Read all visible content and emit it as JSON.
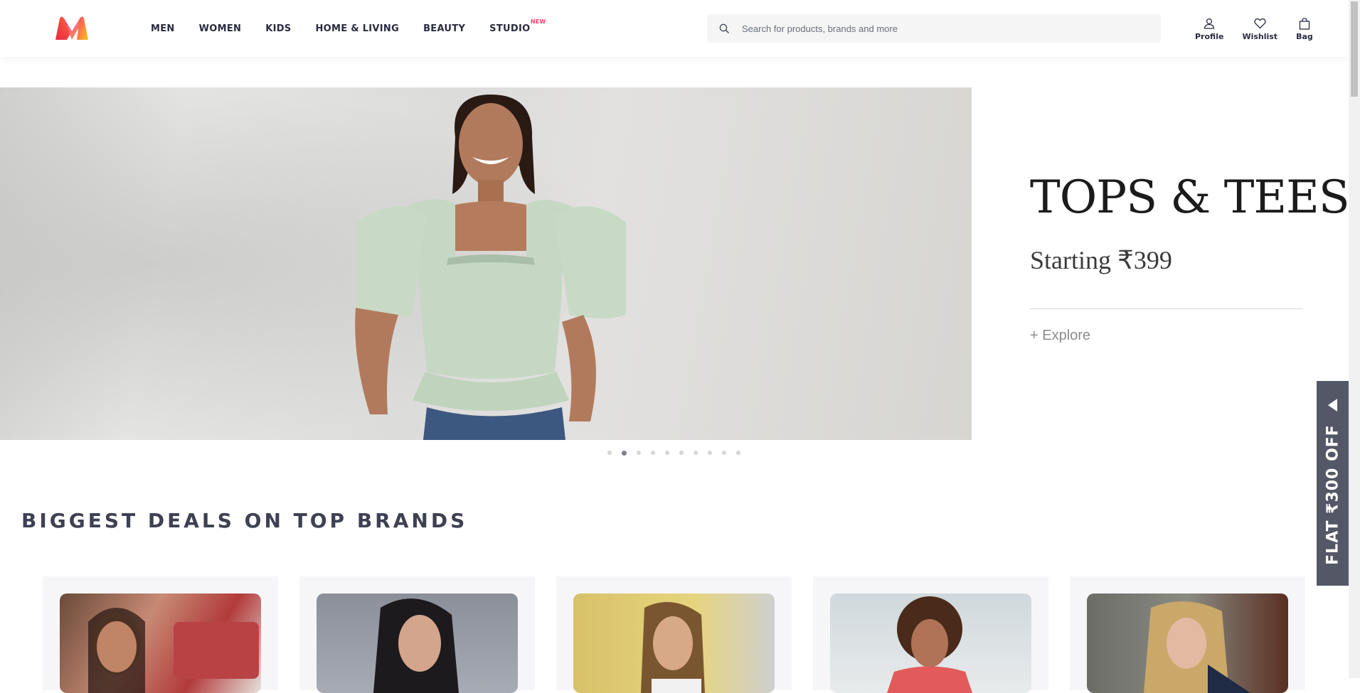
{
  "header": {
    "logo_name": "myntra-logo",
    "nav": [
      {
        "label": "MEN"
      },
      {
        "label": "WOMEN"
      },
      {
        "label": "KIDS"
      },
      {
        "label": "HOME & LIVING"
      },
      {
        "label": "BEAUTY"
      },
      {
        "label": "STUDIO",
        "badge": "NEW"
      }
    ],
    "search": {
      "placeholder": "Search for products, brands and more",
      "value": ""
    },
    "actions": [
      {
        "label": "Profile",
        "icon": "profile-icon"
      },
      {
        "label": "Wishlist",
        "icon": "heart-icon"
      },
      {
        "label": "Bag",
        "icon": "bag-icon"
      }
    ]
  },
  "banner": {
    "title": "TOPS & TEES",
    "subtitle": "Starting ₹399",
    "link": "+ Explore",
    "slide_count": 10,
    "active_slide": 2
  },
  "section": {
    "title": "BIGGEST DEALS ON TOP BRANDS"
  },
  "deal_cards": [
    {
      "icon": "model-photo"
    },
    {
      "icon": "model-photo"
    },
    {
      "icon": "model-photo"
    },
    {
      "icon": "model-photo"
    },
    {
      "icon": "model-photo"
    }
  ],
  "promo": {
    "label": "FLAT ₹300 OFF"
  },
  "colors": {
    "brand_pink": "#ff3f6c",
    "text": "#282c3f",
    "promo_bg": "#535766"
  }
}
